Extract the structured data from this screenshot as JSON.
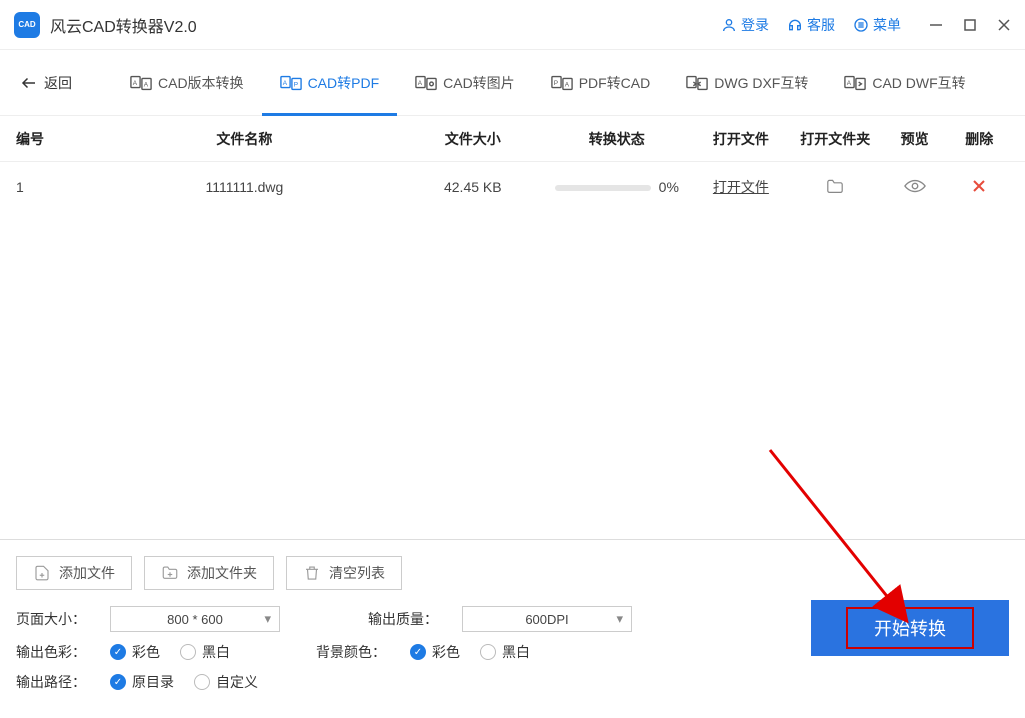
{
  "titlebar": {
    "app_title": "风云CAD转换器V2.0",
    "login": "登录",
    "service": "客服",
    "menu": "菜单"
  },
  "tabs": {
    "back": "返回",
    "items": [
      {
        "label": "CAD版本转换"
      },
      {
        "label": "CAD转PDF"
      },
      {
        "label": "CAD转图片"
      },
      {
        "label": "PDF转CAD"
      },
      {
        "label": "DWG DXF互转"
      },
      {
        "label": "CAD DWF互转"
      }
    ]
  },
  "table": {
    "headers": {
      "num": "编号",
      "name": "文件名称",
      "size": "文件大小",
      "status": "转换状态",
      "open": "打开文件",
      "folder": "打开文件夹",
      "preview": "预览",
      "delete": "删除"
    },
    "rows": [
      {
        "num": "1",
        "name": "1111111.dwg",
        "size": "42.45 KB",
        "progress": "0%",
        "open": "打开文件"
      }
    ]
  },
  "buttons": {
    "add_file": "添加文件",
    "add_folder": "添加文件夹",
    "clear": "清空列表"
  },
  "options": {
    "page_size_label": "页面大小：",
    "page_size_value": "800 * 600",
    "quality_label": "输出质量：",
    "quality_value": "600DPI",
    "color_label": "输出色彩：",
    "color_opt1": "彩色",
    "color_opt2": "黑白",
    "bg_label": "背景颜色：",
    "bg_opt1": "彩色",
    "bg_opt2": "黑白",
    "path_label": "输出路径：",
    "path_opt1": "原目录",
    "path_opt2": "自定义"
  },
  "start": "开始转换"
}
